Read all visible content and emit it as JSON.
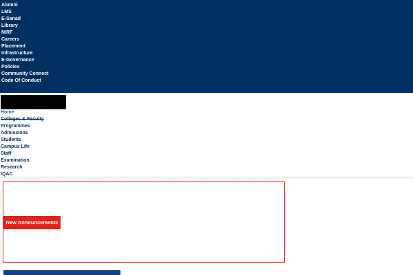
{
  "top_links": [
    "Alumni",
    "LMS",
    "E-Sanad",
    "Library",
    "NIRF",
    "Careers",
    "Placement",
    "Infrastructure",
    "E-Governance",
    "Policies",
    "Community Connect",
    "Code Of Conduct"
  ],
  "main_nav": [
    "Home",
    "Colleges & Faculty",
    "Programmes",
    "Admissions",
    "Students",
    "Campus Life",
    "Staff",
    "Examination",
    "Research",
    "IQAC"
  ],
  "announcements": {
    "label": "New Announcements"
  },
  "colors": {
    "header_bg": "#00305f",
    "accent_red": "#e2231a",
    "link_blue": "#1f5fb4"
  }
}
